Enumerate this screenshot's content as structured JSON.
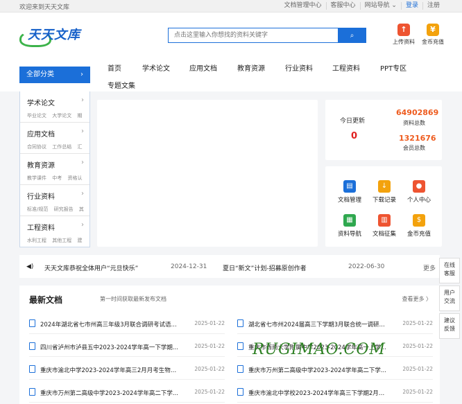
{
  "topbar": {
    "welcome": "欢迎来到天天文库",
    "links": [
      "文档管理中心",
      "客服中心",
      "网站导航 ⌄",
      "登录",
      "注册"
    ]
  },
  "logo": {
    "text": "天天文库"
  },
  "search": {
    "placeholder": "点击这里输入你想找的资料关键字",
    "button": "⌕"
  },
  "header_buttons": [
    {
      "label": "上传资料",
      "icon": "upload-icon",
      "color": "#ee5431"
    },
    {
      "label": "金币充值",
      "icon": "coin-icon",
      "color": "#f3a20d"
    }
  ],
  "nav": {
    "all_label": "全部分类",
    "items": [
      "首页",
      "学术论文",
      "应用文档",
      "教育资源",
      "行业资料",
      "工程资料",
      "PPT专区",
      "专题文集"
    ]
  },
  "categories": [
    {
      "title": "学术论文",
      "subs": [
        "毕业论文",
        "大学论文",
        "期"
      ]
    },
    {
      "title": "应用文档",
      "subs": [
        "合同协议",
        "工作总结",
        "汇"
      ]
    },
    {
      "title": "教育资源",
      "subs": [
        "教学课件",
        "中考",
        "资格认"
      ]
    },
    {
      "title": "行业资料",
      "subs": [
        "标准/规范",
        "研究报告",
        "其"
      ]
    },
    {
      "title": "工程资料",
      "subs": [
        "水利工程",
        "其他工程",
        "建"
      ]
    }
  ],
  "stats": {
    "today_label": "今日更新",
    "today_value": "0",
    "total_docs": "64902869",
    "total_docs_label": "资料总数",
    "members": "1321676",
    "members_label": "会员总数"
  },
  "shortcuts": [
    {
      "label": "文档管理",
      "color": "#1b6fd9"
    },
    {
      "label": "下载记录",
      "color": "#f3a20d"
    },
    {
      "label": "个人中心",
      "color": "#ee5431"
    },
    {
      "label": "资料导航",
      "color": "#2fa84f"
    },
    {
      "label": "文档征集",
      "color": "#ee5431"
    },
    {
      "label": "金币充值",
      "color": "#f3a20d"
    }
  ],
  "news": {
    "items": [
      {
        "title": "天天文库恭祝全体用户“元旦快乐”",
        "date": "2024-12-31"
      },
      {
        "title": "夏日“新文”计划-招募原创作者",
        "date": "2022-06-30"
      }
    ],
    "more": "更多"
  },
  "latest": {
    "heading": "最新文档",
    "subheading": "第一时间获取最新发布文档",
    "more": "查看更多 〉",
    "docs": [
      {
        "title": "2024年湖北省七市州高三年级3月联合调研考试语...",
        "date": "2025-01-22"
      },
      {
        "title": "湖北省七市州2024届高三下学期3月联合统一调研...",
        "date": "2025-01-22"
      },
      {
        "title": "四川省泸州市泸县五中2023-2024学年高一下学期...",
        "date": "2025-01-22"
      },
      {
        "title": "重庆市西南大学附属中学2023-2024学年高一上学...",
        "date": "2025-01-22"
      },
      {
        "title": "重庆市渝北中学2023-2024学年高三2月月考生物试...",
        "date": "2025-01-22"
      },
      {
        "title": "重庆市万州第二高级中学2023-2024学年高二下学...",
        "date": "2025-01-22"
      },
      {
        "title": "重庆市万州第二高级中学2023-2024学年高二下学...",
        "date": "2025-01-22"
      },
      {
        "title": "重庆市渝北中学校2023-2024学年高三下学期2月月...",
        "date": "2025-01-22"
      }
    ]
  },
  "float_buttons": [
    {
      "line1": "在线",
      "line2": "客服"
    },
    {
      "line1": "用户",
      "line2": "交流"
    },
    {
      "line1": "建议",
      "line2": "反馈"
    }
  ],
  "watermark": "RUGIMAO.COM"
}
